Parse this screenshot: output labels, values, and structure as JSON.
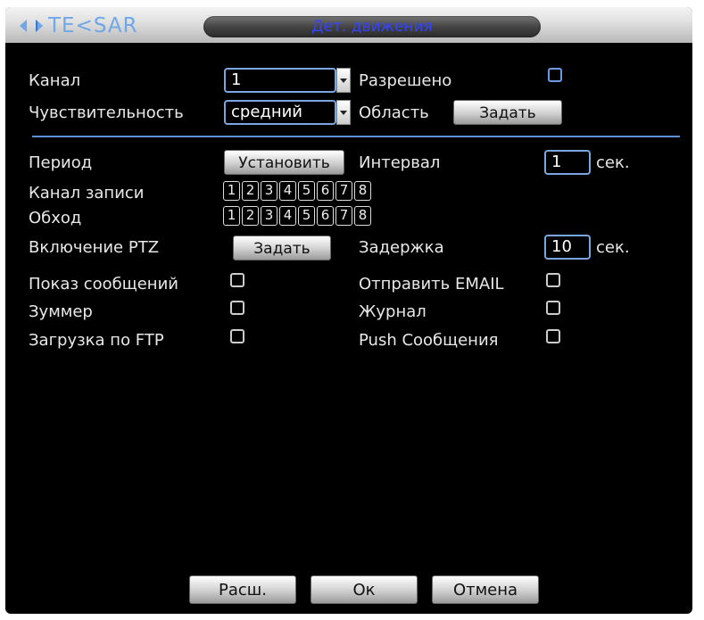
{
  "header": {
    "brand": "TE<SAR",
    "title": "Дет. движения",
    "brand_color": "#6fa8e8",
    "title_color": "#3344ff"
  },
  "form": {
    "channel_label": "Канал",
    "channel_value": "1",
    "enabled_label": "Разрешено",
    "sensitivity_label": "Чувствительность",
    "sensitivity_value": "средний",
    "area_label": "Область",
    "area_button": "Задать",
    "period_label": "Период",
    "period_button": "Установить",
    "interval_label": "Интервал",
    "interval_value": "1",
    "interval_unit": "сек.",
    "record_channel_label": "Канал записи",
    "record_channels": [
      "1",
      "2",
      "3",
      "4",
      "5",
      "6",
      "7",
      "8"
    ],
    "tour_label": "Обход",
    "tour_channels": [
      "1",
      "2",
      "3",
      "4",
      "5",
      "6",
      "7",
      "8"
    ],
    "ptz_label": "Включение PTZ",
    "ptz_button": "Задать",
    "delay_label": "Задержка",
    "delay_value": "10",
    "delay_unit": "сек.",
    "show_message_label": "Показ сообщений",
    "send_email_label": "Отправить EMAIL",
    "buzzer_label": "Зуммер",
    "log_label": "Журнал",
    "ftp_upload_label": "Загрузка по FTP",
    "push_label": "Push Сообщения"
  },
  "footer": {
    "advanced_button": "Расш.",
    "ok_button": "Ок",
    "cancel_button": "Отмена"
  },
  "colors": {
    "background": "#000000",
    "accent": "#5b8fd6",
    "text": "#e8e8e8"
  }
}
